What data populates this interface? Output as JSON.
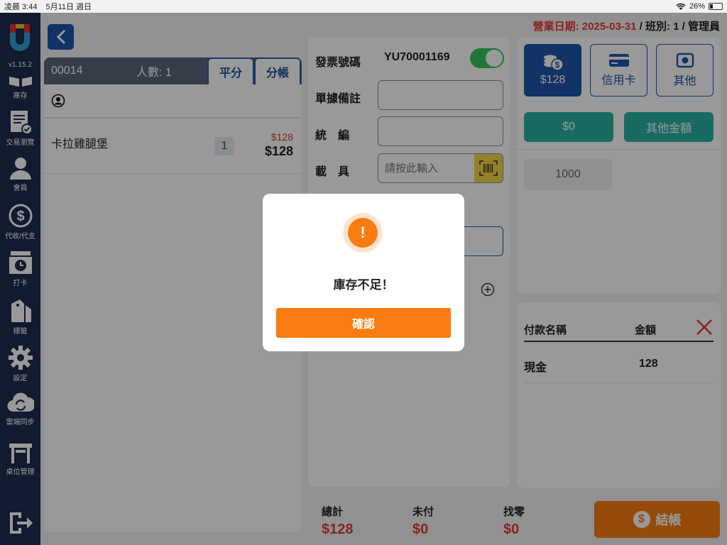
{
  "status_bar": {
    "time": "凌晨 3:44",
    "date": "5月11日 週日",
    "battery": "26%",
    "battery_level": 0.26
  },
  "app": {
    "version": "v1.15.2",
    "brand_color": "#1d2c4d",
    "accent_color": "#fa7c11"
  },
  "sidebar": {
    "items": [
      {
        "label": "庫存",
        "icon": "box-icon"
      },
      {
        "label": "交易瀏覽",
        "icon": "receipt-check-icon"
      },
      {
        "label": "會員",
        "icon": "person-icon"
      },
      {
        "label": "代收/代支",
        "icon": "dollar-cycle-icon"
      },
      {
        "label": "打卡",
        "icon": "punch-clock-icon"
      },
      {
        "label": "標籤",
        "icon": "tag-icon"
      },
      {
        "label": "設定",
        "icon": "gear-icon"
      },
      {
        "label": "雲端同步",
        "icon": "cloud-sync-icon"
      },
      {
        "label": "桌位管理",
        "icon": "table-icon"
      }
    ],
    "logout_icon": "logout-icon"
  },
  "header": {
    "biz_date_label": "營業日期: 2025-03-31",
    "shift_info": " / 班別: 1 / 管理員"
  },
  "order": {
    "number": "00014",
    "people": "人數: 1",
    "tabs": [
      "平分",
      "分帳"
    ],
    "items": [
      {
        "name": "卡拉雞腿堡",
        "qty": "1",
        "orig_price": "$128",
        "price": "$128"
      }
    ]
  },
  "invoice": {
    "invoice_no_label": "發票號碼",
    "invoice_no": "YU70001169",
    "toggle_on": true,
    "note_label": "單據備註",
    "tax_id_label": "統　編",
    "carrier_label": "載　具",
    "carrier_placeholder": "請按此輸入"
  },
  "payment": {
    "methods": [
      "$128",
      "信用卡",
      "其他"
    ],
    "amount_zero": "$0",
    "other_amount": "其他金額",
    "quick_amount": "1000"
  },
  "pay_list": {
    "col_name": "付款名稱",
    "col_amount": "金額",
    "rows": [
      {
        "name": "現金",
        "amount": "128"
      }
    ]
  },
  "totals": {
    "total_label": "總計",
    "total": "$128",
    "unpaid_label": "未付",
    "unpaid": "$0",
    "change_label": "找零",
    "change": "$0",
    "checkout_label": "結帳"
  },
  "dialog": {
    "message": "庫存不足！",
    "confirm_label": "確認",
    "icon": "exclamation-icon"
  }
}
